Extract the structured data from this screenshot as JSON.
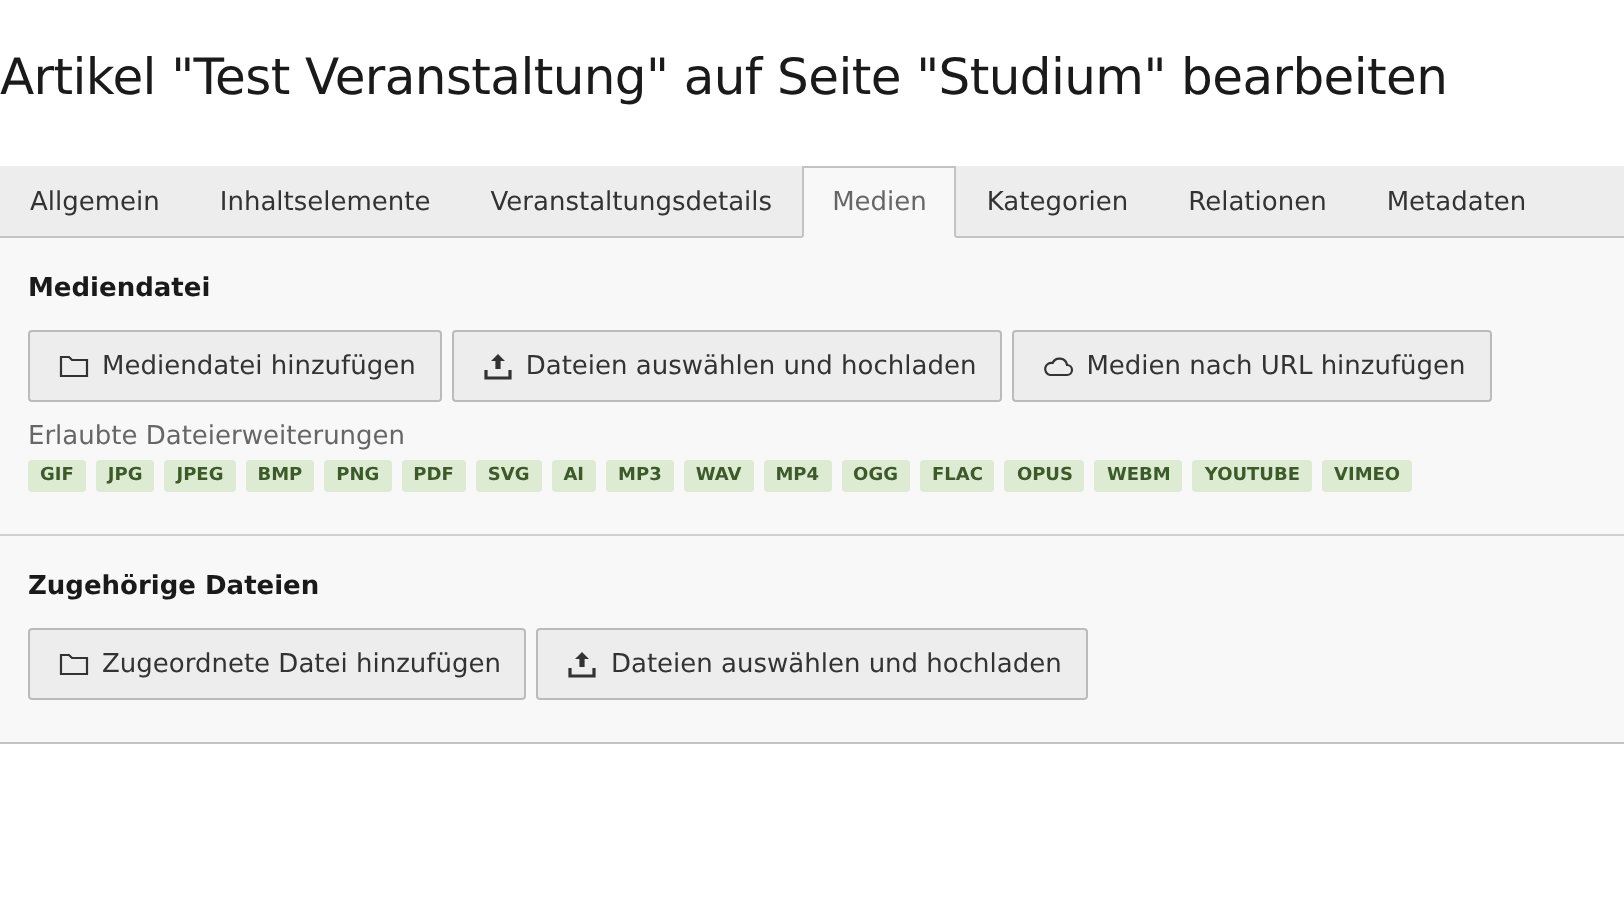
{
  "title": "Artikel \"Test Veranstaltung\" auf Seite \"Studium\" bearbeiten",
  "tabs": [
    {
      "label": "Allgemein",
      "selected": false
    },
    {
      "label": "Inhaltselemente",
      "selected": false
    },
    {
      "label": "Veranstaltungsdetails",
      "selected": false
    },
    {
      "label": "Medien",
      "selected": true
    },
    {
      "label": "Kategorien",
      "selected": false
    },
    {
      "label": "Relationen",
      "selected": false
    },
    {
      "label": "Metadaten",
      "selected": false
    }
  ],
  "sections": [
    {
      "heading": "Mediendatei",
      "buttons": [
        {
          "kind": "folder",
          "label": "Mediendatei hinzufügen"
        },
        {
          "kind": "upload",
          "label": "Dateien auswählen und hochladen"
        },
        {
          "kind": "cloud",
          "label": "Medien nach URL hinzufügen"
        }
      ],
      "extensions_label": "Erlaubte Dateierweiterungen",
      "extensions": [
        "GIF",
        "JPG",
        "JPEG",
        "BMP",
        "PNG",
        "PDF",
        "SVG",
        "AI",
        "MP3",
        "WAV",
        "MP4",
        "OGG",
        "FLAC",
        "OPUS",
        "WEBM",
        "YOUTUBE",
        "VIMEO"
      ]
    },
    {
      "heading": "Zugehörige Dateien",
      "buttons": [
        {
          "kind": "folder",
          "label": "Zugeordnete Datei hinzufügen"
        },
        {
          "kind": "upload",
          "label": "Dateien auswählen und hochladen"
        }
      ]
    }
  ]
}
